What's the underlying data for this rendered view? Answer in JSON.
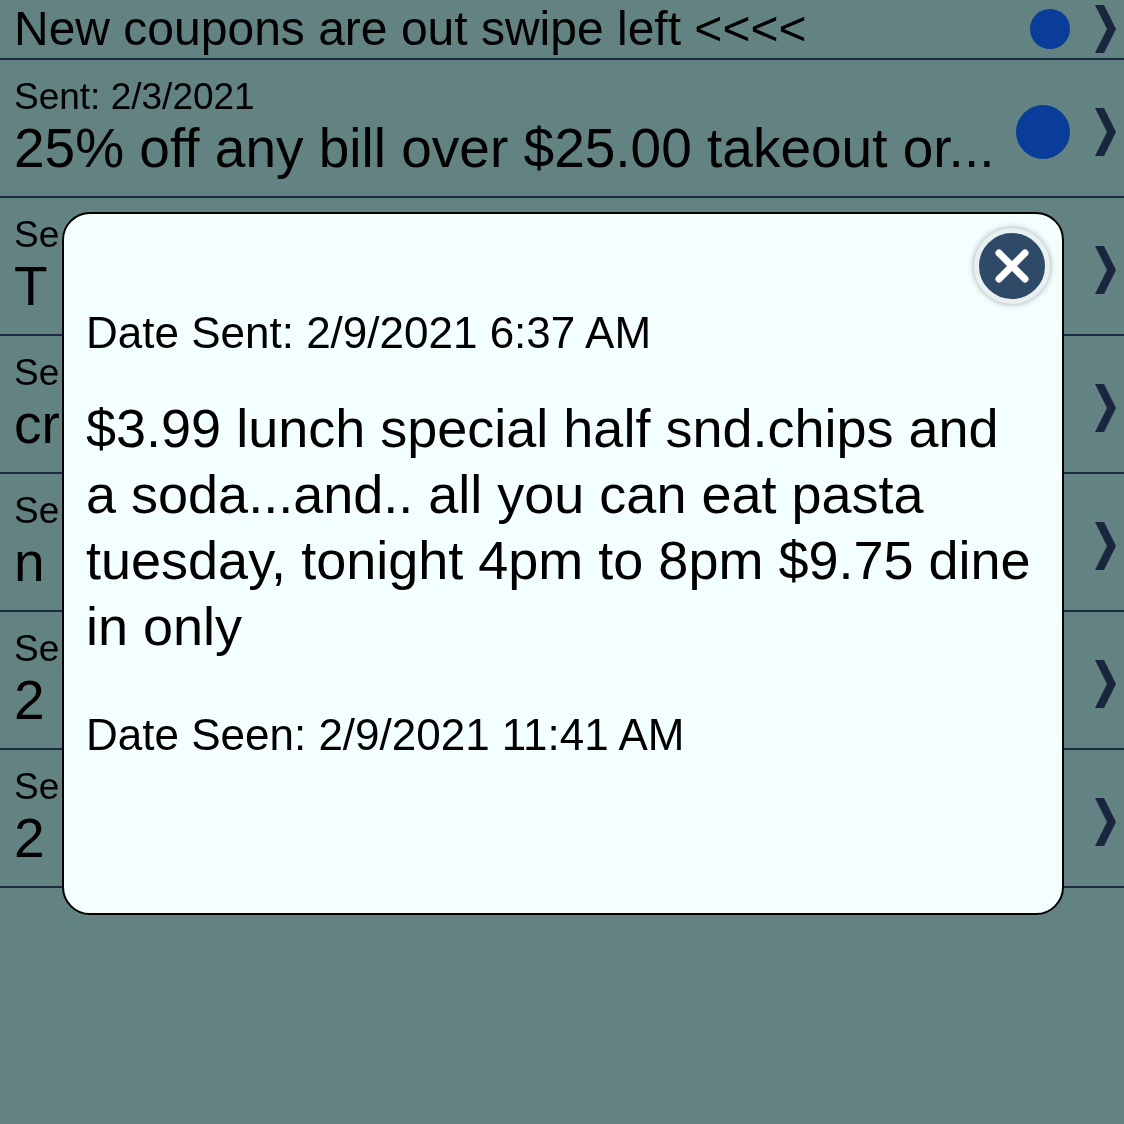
{
  "messages": [
    {
      "message": "New coupons are out swipe left <<<<",
      "unread": true
    },
    {
      "sent": "Sent: 2/3/2021",
      "message": "25% off any bill over $25.00 takeout or...",
      "unread": true
    },
    {
      "sent": "Se",
      "message": "T"
    },
    {
      "sent": "Se",
      "message": "cr"
    },
    {
      "sent": "Se",
      "message": "n"
    },
    {
      "sent": "Se",
      "message": "2"
    },
    {
      "sent": "Se",
      "message": "2"
    }
  ],
  "dialog": {
    "date_sent": "Date Sent: 2/9/2021 6:37 AM",
    "body": "$3.99 lunch special half snd.chips and a soda...and.. all you can eat pasta tuesday, tonight 4pm to 8pm $9.75 dine in only",
    "date_seen": "Date Seen: 2/9/2021 11:41 AM"
  }
}
